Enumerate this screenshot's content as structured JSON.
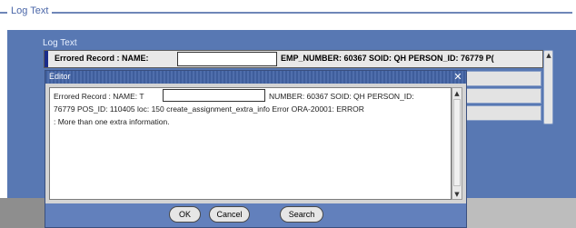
{
  "fieldset": {
    "title": "Log Text"
  },
  "panel": {
    "label": "Log Text",
    "errored_prefix": "Errored Record :  NAME:",
    "errored_suffix": "EMP_NUMBER: 60367 SOID: QH PERSON_ID: 76779 P("
  },
  "dialog": {
    "title": "Editor",
    "close_glyph": "✕",
    "text_lines": [
      "Errored Record :  NAME: T",
      "NUMBER: 60367 SOID: QH PERSON_ID:",
      "76779 POS_ID: 110405 loc: 150  create_assignment_extra_info   Error ORA-20001: ERROR",
      ": More than one extra information."
    ],
    "buttons": {
      "ok": "OK",
      "cancel": "Cancel",
      "search": "Search"
    }
  },
  "colors": {
    "panel_blue": "#5878b3",
    "title_blue": "#4a66a8",
    "dialog_bg": "#d4d4d4",
    "button_bar": "#6280bc"
  },
  "icons": {
    "close": "close-icon",
    "scroll_up": "scroll-up-icon",
    "scroll_down": "scroll-down-icon"
  }
}
